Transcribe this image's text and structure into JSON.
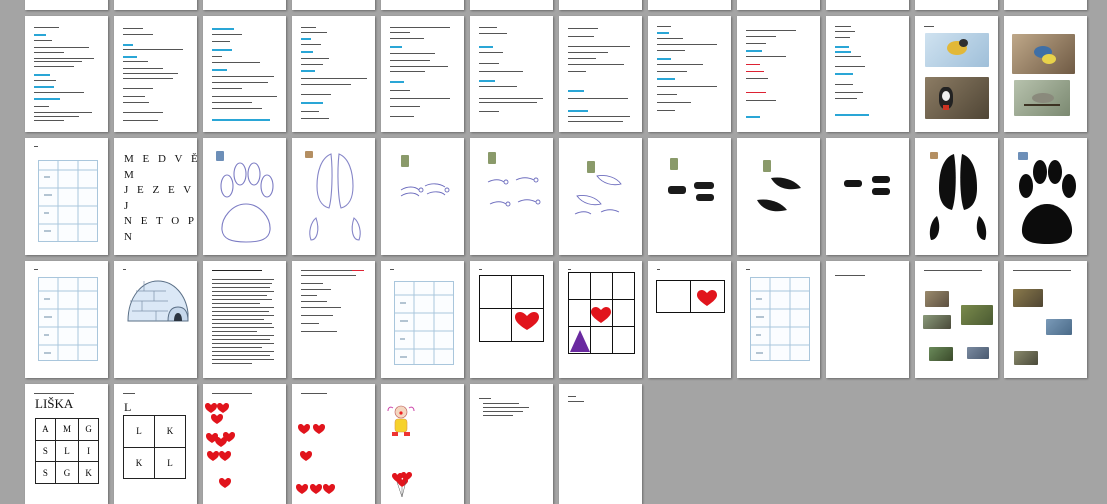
{
  "view": {
    "app": "document page thumbnail overview",
    "background_color": "#a4a4a4",
    "accent_color": "#2aa6d6"
  },
  "pages": {
    "p_medved": {
      "lines": [
        "M E D V Ě D",
        "M",
        "J E Z E V E C",
        "J",
        "N E T O P Y R",
        "N"
      ]
    },
    "p_liska": {
      "title": "LIŠKA",
      "grid": [
        [
          "A",
          "M",
          "G"
        ],
        [
          "S",
          "L",
          "I"
        ],
        [
          "S",
          "G",
          "K"
        ]
      ]
    },
    "p_l_grid": {
      "title": "L",
      "grid": [
        [
          "L",
          "K"
        ],
        [
          "K",
          "L"
        ]
      ]
    },
    "icons": {
      "paw_print": "paw-print-outline",
      "hoof_print": "hoof-print-outline",
      "igloo": "igloo-illustration",
      "heart": "red-heart",
      "triangle": "purple-triangle",
      "clown": "clown-illustration",
      "balloons": "heart-balloons"
    }
  }
}
